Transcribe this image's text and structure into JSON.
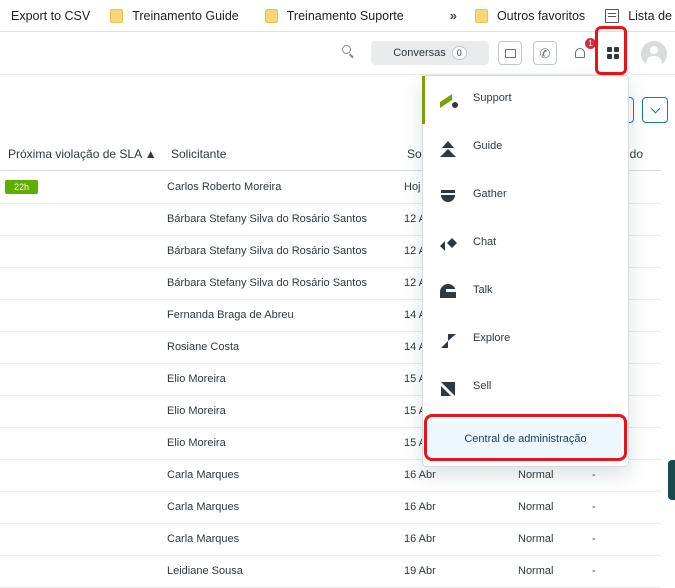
{
  "bookmarks": {
    "export": "Export to CSV",
    "folder1": "Treinamento Guide",
    "folder2": "Treinamento Suporte",
    "more": "»",
    "folder3": "Outros favoritos",
    "reading_list": "Lista de leitura"
  },
  "header": {
    "conversas_label": "Conversas",
    "conversas_count": "0",
    "notification_count": "1"
  },
  "table": {
    "columns": [
      "Próxima violação de SLA ▲",
      "Solicitante",
      "So",
      "ido"
    ],
    "rows": [
      {
        "sla": "22h",
        "requester": "Carlos Roberto Moreira",
        "date": "Hoj",
        "priority": "",
        "extra": ""
      },
      {
        "sla": "",
        "requester": "Bárbara Stefany Silva do Rosário Santos",
        "date": "12 A",
        "priority": "",
        "extra": ""
      },
      {
        "sla": "",
        "requester": "Bárbara Stefany Silva do Rosário Santos",
        "date": "12 A",
        "priority": "",
        "extra": ""
      },
      {
        "sla": "",
        "requester": "Bárbara Stefany Silva do Rosário Santos",
        "date": "12 A",
        "priority": "",
        "extra": ""
      },
      {
        "sla": "",
        "requester": "Fernanda Braga de Abreu",
        "date": "14 A",
        "priority": "",
        "extra": ""
      },
      {
        "sla": "",
        "requester": "Rosiane Costa",
        "date": "14 A",
        "priority": "",
        "extra": ""
      },
      {
        "sla": "",
        "requester": "Elio Moreira",
        "date": "15 A",
        "priority": "",
        "extra": ""
      },
      {
        "sla": "",
        "requester": "Elio Moreira",
        "date": "15 A",
        "priority": "",
        "extra": ""
      },
      {
        "sla": "",
        "requester": "Elio Moreira",
        "date": "15 A",
        "priority": "",
        "extra": ""
      },
      {
        "sla": "",
        "requester": "Carla Marques",
        "date": "16 Abr",
        "priority": "Normal",
        "extra": "-"
      },
      {
        "sla": "",
        "requester": "Carla Marques",
        "date": "16 Abr",
        "priority": "Normal",
        "extra": "-"
      },
      {
        "sla": "",
        "requester": "Carla Marques",
        "date": "16 Abr",
        "priority": "Normal",
        "extra": "-"
      },
      {
        "sla": "",
        "requester": "Leidiane Sousa",
        "date": "19 Abr",
        "priority": "Normal",
        "extra": "-"
      }
    ]
  },
  "product_menu": {
    "items": [
      {
        "label": "Support",
        "icon": "support-icon"
      },
      {
        "label": "Guide",
        "icon": "guide-icon"
      },
      {
        "label": "Gather",
        "icon": "gather-icon"
      },
      {
        "label": "Chat",
        "icon": "chat-icon"
      },
      {
        "label": "Talk",
        "icon": "talk-icon"
      },
      {
        "label": "Explore",
        "icon": "explore-icon"
      },
      {
        "label": "Sell",
        "icon": "sell-icon"
      }
    ],
    "admin_label": "Central de administração"
  },
  "colors": {
    "sla_green": "#5eae00",
    "support_green": "#78a300",
    "highlight_red": "#e8141c",
    "admin_bg": "#edf7ff"
  }
}
